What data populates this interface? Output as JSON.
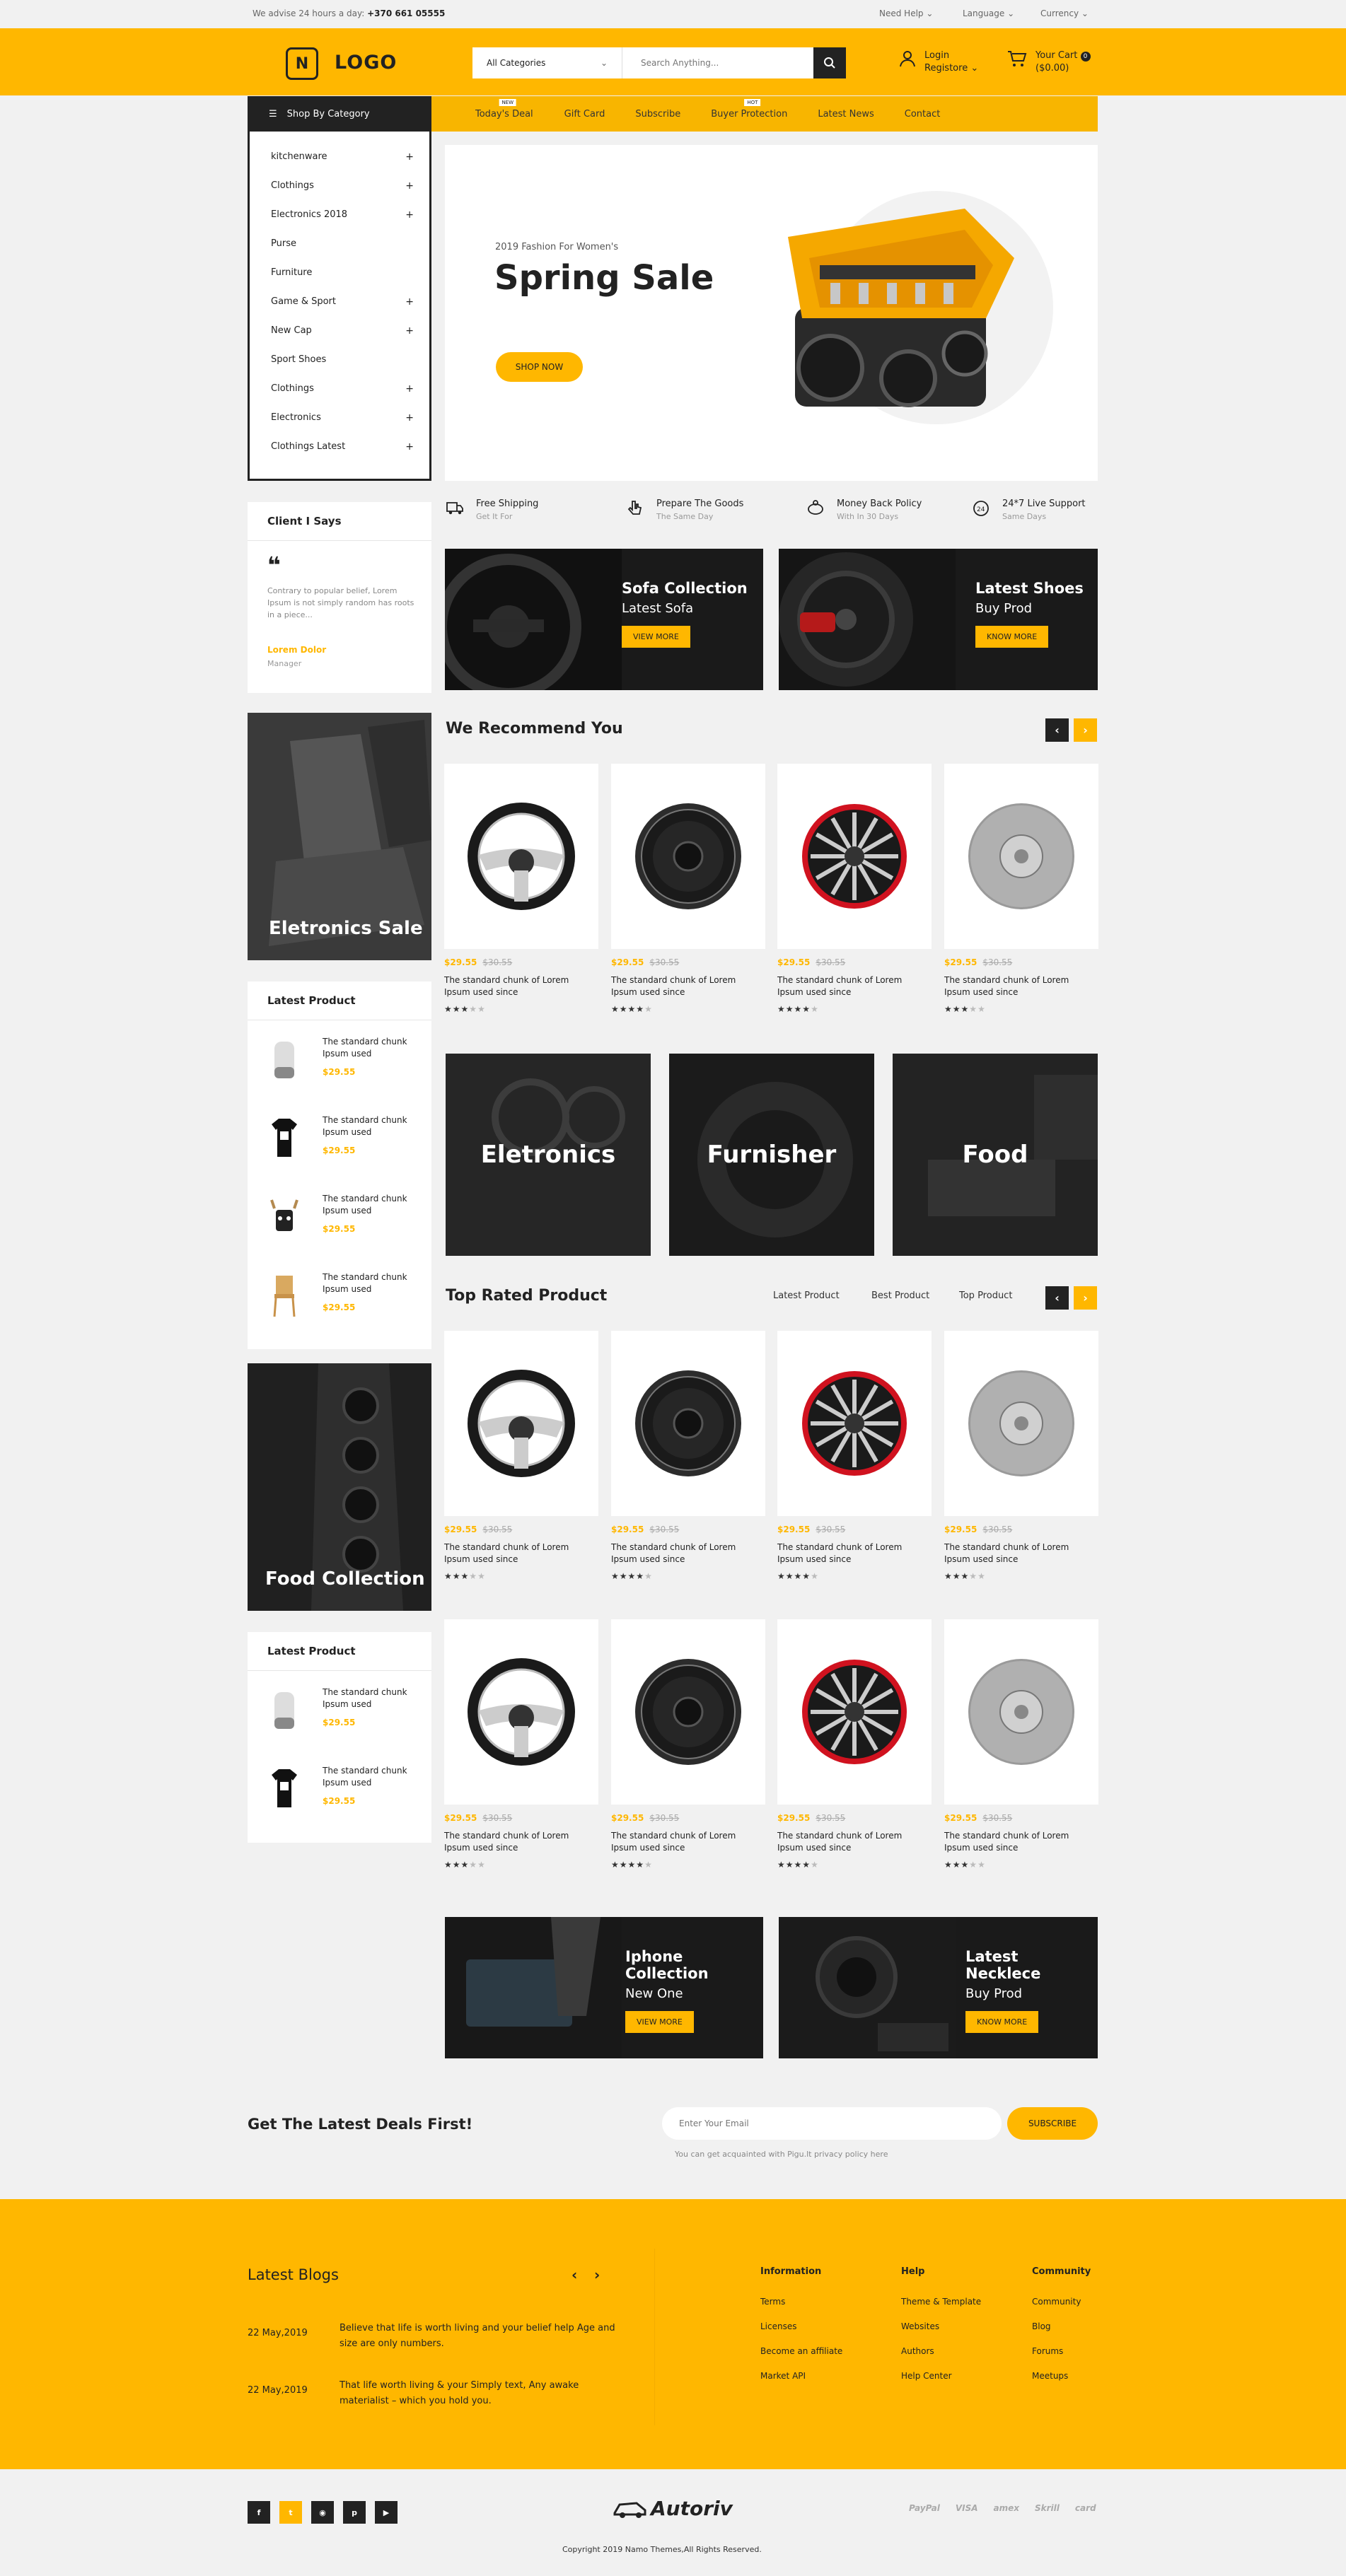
{
  "topbar": {
    "advise": "We advise 24 hours a day: ",
    "phone": "+370 661 05555",
    "help": "Need Help",
    "language": "Language",
    "currency": "Currency"
  },
  "header": {
    "logo_letter": "N",
    "logo_text": "LOGO",
    "category_select": "All Categories",
    "search_placeholder": "Search Anything...",
    "login": "Login",
    "register": "Registore",
    "cart_title": "Your Cart",
    "cart_count": "0",
    "cart_total": "($0.00)"
  },
  "nav": {
    "shop_by_category": "Shop By Category",
    "items": [
      {
        "label": "Today's Deal",
        "badge": "NEW"
      },
      {
        "label": "Gift Card",
        "badge": ""
      },
      {
        "label": "Subscribe",
        "badge": ""
      },
      {
        "label": "Buyer Protection",
        "badge": "HOT"
      },
      {
        "label": "Latest News",
        "badge": ""
      },
      {
        "label": "Contact",
        "badge": ""
      }
    ]
  },
  "categories": [
    {
      "label": "kitchenware",
      "plus": "+"
    },
    {
      "label": "Clothings",
      "plus": "+"
    },
    {
      "label": "Electronics 2018",
      "plus": "+"
    },
    {
      "label": "Purse",
      "plus": ""
    },
    {
      "label": "Furniture",
      "plus": ""
    },
    {
      "label": "Game & Sport",
      "plus": "+"
    },
    {
      "label": "New Cap",
      "plus": "+"
    },
    {
      "label": "Sport Shoes",
      "plus": ""
    },
    {
      "label": "Clothings",
      "plus": "+"
    },
    {
      "label": "Electronics",
      "plus": "+"
    },
    {
      "label": "Clothings Latest",
      "plus": "+"
    }
  ],
  "hero": {
    "kicker": "2019 Fashion For Women's",
    "title": "Spring Sale",
    "button": "SHOP NOW"
  },
  "features": [
    {
      "title": "Free Shipping",
      "sub": "Get It For",
      "icon": "truck-icon"
    },
    {
      "title": "Prepare The Goods",
      "sub": "The Same Day",
      "icon": "hand-icon"
    },
    {
      "title": "Money Back Policy",
      "sub": "With In 30 Days",
      "icon": "piggy-bank-icon"
    },
    {
      "title": "24*7 Live  Support",
      "sub": "Same Days",
      "icon": "support-24-icon"
    }
  ],
  "testimonial": {
    "title": "Client I Says",
    "quote": "Contrary to popular belief, Lorem Ipsum is not simply random has roots in a piece...",
    "name": "Lorem Dolor",
    "role": "Manager"
  },
  "promo1": {
    "title": "Sofa Collection",
    "sub": "Latest Sofa",
    "button": "VIEW MORE"
  },
  "promo2": {
    "title": "Latest Shoes",
    "sub": "Buy Prod",
    "button": "KNOW MORE"
  },
  "side_banner1": "Eletronics Sale",
  "side_banner2": "Food Collection",
  "recommend": {
    "title": "We Recommend You"
  },
  "products": [
    {
      "price": "$29.55",
      "old": "$30.55",
      "name": "The standard chunk of Lorem Ipsum used since",
      "rating": 3,
      "icon": "steering-wheel-icon"
    },
    {
      "price": "$29.55",
      "old": "$30.55",
      "name": "The standard chunk of Lorem Ipsum used since",
      "rating": 4,
      "icon": "speaker-icon"
    },
    {
      "price": "$29.55",
      "old": "$30.55",
      "name": "The standard chunk of Lorem Ipsum used since",
      "rating": 4,
      "icon": "rim-icon"
    },
    {
      "price": "$29.55",
      "old": "$30.55",
      "name": "The standard chunk of Lorem Ipsum used since",
      "rating": 3,
      "icon": "brake-disc-icon"
    }
  ],
  "latest_product": {
    "title": "Latest Product",
    "items": [
      {
        "name": "The standard chunk Ipsum used",
        "price": "$29.55",
        "icon": "smart-speaker-icon"
      },
      {
        "name": "The standard chunk Ipsum used",
        "price": "$29.55",
        "icon": "tshirt-icon"
      },
      {
        "name": "The standard chunk Ipsum used",
        "price": "$29.55",
        "icon": "toy-icon"
      },
      {
        "name": "The standard chunk Ipsum used",
        "price": "$29.55",
        "icon": "chair-icon"
      }
    ]
  },
  "category_banners": [
    "Eletronics",
    "Furnisher",
    "Food"
  ],
  "top_rated": {
    "title": "Top Rated Product",
    "tabs": [
      "Latest Product",
      "Best Product",
      "Top Product"
    ]
  },
  "promo3": {
    "title": "Iphone Collection",
    "sub": "New One",
    "button": "VIEW MORE"
  },
  "promo4": {
    "title": "Latest Necklece",
    "sub": "Buy Prod",
    "button": "KNOW MORE"
  },
  "newsletter": {
    "title": "Get The Latest Deals First!",
    "placeholder": "Enter Your Email",
    "button": "SUBSCRIBE",
    "note": "You can get acquainted with Pigu.lt privacy policy here"
  },
  "blogs": {
    "title": "Latest Blogs",
    "items": [
      {
        "date": "22 May,2019",
        "text": "Believe that life is worth living and your belief help Age and size are only numbers."
      },
      {
        "date": "22 May,2019",
        "text": "That life worth living & your Simply text, Any awake materialist – which you hold you."
      }
    ]
  },
  "footer_cols": [
    {
      "title": "Information",
      "links": [
        "Terms",
        "Licenses",
        "Become an affiliate",
        "Market API"
      ]
    },
    {
      "title": "Help",
      "links": [
        "Theme & Template",
        "Websites",
        "Authors",
        "Help Center"
      ]
    },
    {
      "title": "Community",
      "links": [
        "Community",
        "Blog",
        "Forums",
        "Meetups"
      ]
    }
  ],
  "bottom": {
    "brand": "Autoriv",
    "copyright": "Copyright 2019 Namo Themes,All Rights Reserved.",
    "social": [
      "f",
      "t",
      "rss",
      "p",
      "yt"
    ],
    "payments": [
      "PayPal",
      "VISA",
      "amex",
      "Skrill",
      "card"
    ]
  },
  "colors": {
    "accent": "#ffb700",
    "dark": "#222222"
  }
}
